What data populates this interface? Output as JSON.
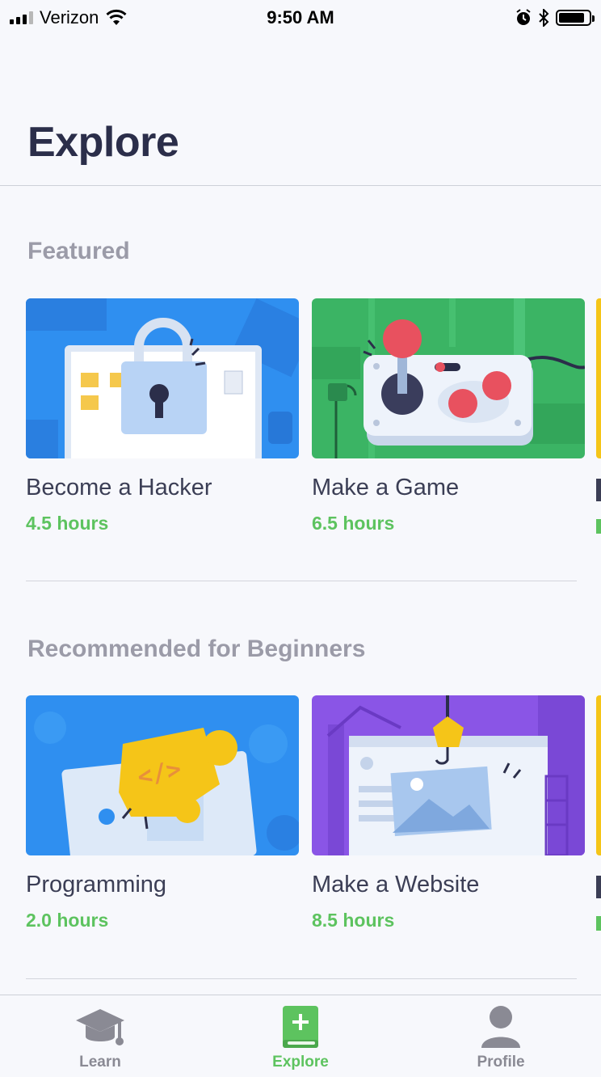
{
  "status_bar": {
    "carrier": "Verizon",
    "time": "9:50 AM",
    "icons": [
      "signal-icon",
      "wifi-icon",
      "alarm-icon",
      "bluetooth-icon",
      "battery-icon"
    ]
  },
  "header": {
    "title": "Explore"
  },
  "sections": [
    {
      "title": "Featured",
      "cards": [
        {
          "title": "Become a Hacker",
          "hours": "4.5 hours",
          "illustration": "padlock-laptop"
        },
        {
          "title": "Make a Game",
          "hours": "6.5 hours",
          "illustration": "game-controller"
        }
      ]
    },
    {
      "title": "Recommended for Beginners",
      "cards": [
        {
          "title": "Programming",
          "hours": "2.0 hours",
          "illustration": "code-puzzle"
        },
        {
          "title": "Make a Website",
          "hours": "8.5 hours",
          "illustration": "web-browser"
        }
      ]
    }
  ],
  "tab_bar": {
    "tabs": [
      {
        "label": "Learn",
        "icon": "graduation-cap-icon",
        "active": false
      },
      {
        "label": "Explore",
        "icon": "book-plus-icon",
        "active": true
      },
      {
        "label": "Profile",
        "icon": "person-icon",
        "active": false
      }
    ]
  },
  "colors": {
    "accent": "#5dc35f",
    "title": "#2b2e4a",
    "section_title": "#9b9ba8",
    "hacker_card": "#2f8ff0",
    "game_card": "#3bb464",
    "programming_card": "#2f8ff0",
    "website_card": "#8a55e6"
  }
}
